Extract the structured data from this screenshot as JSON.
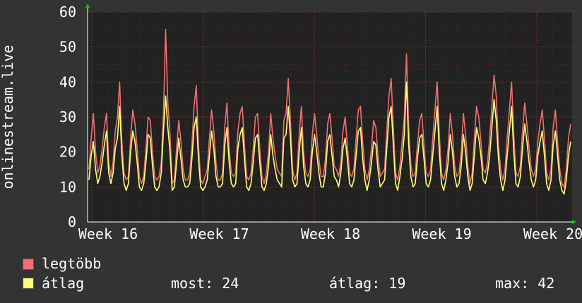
{
  "colors": {
    "background": "#333333",
    "plot_bg": "#222222",
    "grid": "#7a2a2a",
    "grid_minor": "#4a2626",
    "axis_arrow": "#00cc00",
    "series_max": "#f07070",
    "series_avg": "#ffff77"
  },
  "legend": {
    "max_label": "legtöbb",
    "avg_label": "átlag",
    "stat_now": "most: 24",
    "stat_avg": "átlag: 19",
    "stat_max": "max: 42"
  },
  "chart_data": {
    "type": "line",
    "ylabel": "onlinestream.live",
    "ylim": [
      0,
      60
    ],
    "yticks": [
      "0",
      "10",
      "20",
      "30",
      "40",
      "50",
      "60"
    ],
    "xticks": [
      "Week 16",
      "Week 17",
      "Week 18",
      "Week 19",
      "Week 20"
    ],
    "grid": true,
    "series": [
      {
        "name": "legtöbb",
        "values": [
          15,
          24,
          31,
          20,
          14,
          16,
          21,
          27,
          31,
          17,
          13,
          17,
          26,
          30,
          40,
          23,
          14,
          12,
          13,
          24,
          32,
          28,
          21,
          13,
          11,
          13,
          21,
          30,
          29,
          20,
          13,
          12,
          13,
          17,
          31,
          55,
          34,
          25,
          11,
          12,
          21,
          29,
          23,
          15,
          12,
          12,
          14,
          22,
          33,
          39,
          22,
          12,
          11,
          13,
          15,
          24,
          32,
          26,
          17,
          12,
          12,
          14,
          27,
          34,
          21,
          14,
          13,
          14,
          26,
          31,
          33,
          22,
          13,
          12,
          14,
          21,
          30,
          31,
          21,
          13,
          11,
          14,
          20,
          31,
          24,
          19,
          15,
          14,
          13,
          29,
          31,
          41,
          29,
          15,
          12,
          14,
          25,
          33,
          20,
          14,
          13,
          15,
          25,
          31,
          25,
          18,
          13,
          13,
          18,
          28,
          31,
          24,
          16,
          15,
          13,
          17,
          26,
          30,
          22,
          14,
          13,
          15,
          24,
          32,
          33,
          23,
          15,
          12,
          15,
          21,
          29,
          27,
          19,
          13,
          14,
          15,
          26,
          36,
          41,
          27,
          14,
          12,
          16,
          23,
          30,
          48,
          27,
          16,
          13,
          14,
          22,
          29,
          31,
          22,
          14,
          13,
          15,
          24,
          32,
          40,
          25,
          14,
          12,
          15,
          21,
          31,
          25,
          16,
          13,
          14,
          20,
          31,
          25,
          16,
          11,
          14,
          24,
          33,
          30,
          23,
          15,
          14,
          17,
          24,
          33,
          42,
          36,
          22,
          15,
          12,
          15,
          24,
          32,
          40,
          25,
          14,
          13,
          16,
          26,
          34,
          28,
          21,
          15,
          13,
          15,
          23,
          28,
          32,
          24,
          14,
          12,
          15,
          27,
          32,
          23,
          15,
          11,
          10,
          15,
          24,
          28
        ]
      },
      {
        "name": "átlag",
        "values": [
          12,
          19,
          23,
          15,
          11,
          13,
          17,
          22,
          26,
          14,
          11,
          14,
          21,
          24,
          33,
          19,
          11,
          9,
          11,
          20,
          26,
          23,
          17,
          10,
          9,
          11,
          17,
          25,
          24,
          16,
          10,
          9,
          10,
          14,
          26,
          36,
          27,
          20,
          9,
          10,
          17,
          24,
          18,
          12,
          10,
          10,
          11,
          18,
          27,
          30,
          18,
          10,
          9,
          10,
          12,
          19,
          26,
          21,
          13,
          10,
          10,
          11,
          22,
          27,
          17,
          11,
          10,
          11,
          21,
          25,
          27,
          18,
          10,
          9,
          11,
          17,
          24,
          25,
          17,
          10,
          9,
          11,
          16,
          25,
          19,
          15,
          12,
          11,
          10,
          24,
          25,
          33,
          24,
          12,
          10,
          11,
          20,
          27,
          16,
          11,
          10,
          12,
          20,
          25,
          20,
          14,
          10,
          10,
          14,
          23,
          25,
          19,
          13,
          12,
          10,
          14,
          21,
          24,
          18,
          11,
          10,
          12,
          19,
          26,
          27,
          18,
          12,
          9,
          12,
          17,
          23,
          22,
          15,
          10,
          11,
          12,
          21,
          30,
          33,
          22,
          11,
          9,
          13,
          18,
          25,
          40,
          22,
          13,
          10,
          11,
          18,
          24,
          25,
          18,
          11,
          10,
          12,
          19,
          26,
          33,
          20,
          11,
          9,
          12,
          17,
          25,
          20,
          13,
          10,
          11,
          16,
          25,
          20,
          13,
          9,
          11,
          19,
          27,
          24,
          19,
          12,
          11,
          14,
          19,
          27,
          35,
          29,
          18,
          12,
          9,
          12,
          19,
          26,
          33,
          20,
          11,
          10,
          13,
          21,
          28,
          23,
          17,
          12,
          10,
          12,
          19,
          23,
          26,
          19,
          11,
          9,
          12,
          22,
          26,
          19,
          12,
          9,
          8,
          12,
          19,
          23
        ]
      }
    ]
  }
}
